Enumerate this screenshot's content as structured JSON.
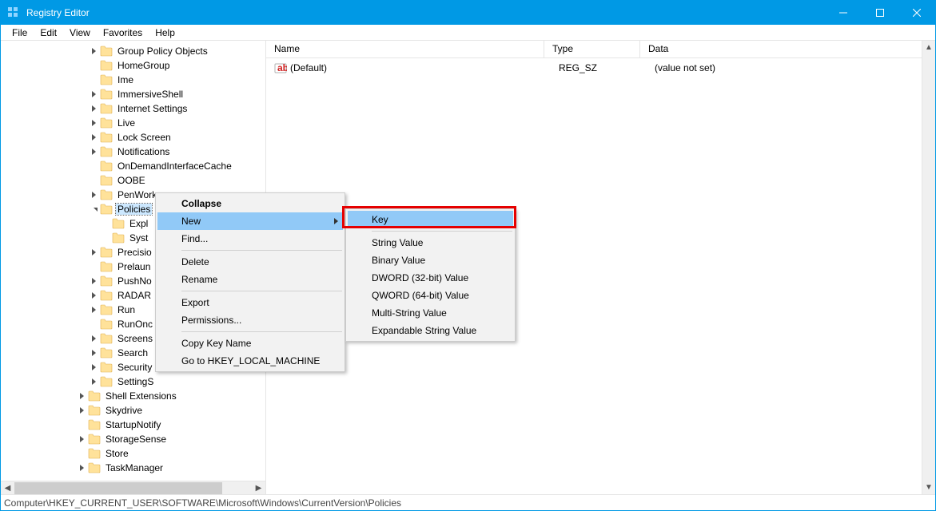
{
  "window": {
    "title": "Registry Editor",
    "minimize": "Minimize",
    "maximize": "Maximize",
    "close": "Close"
  },
  "menubar": {
    "file": "File",
    "edit": "Edit",
    "view": "View",
    "favorites": "Favorites",
    "help": "Help"
  },
  "tree": {
    "items": [
      {
        "indent": 7,
        "expander": "closed",
        "label": "Group Policy Objects"
      },
      {
        "indent": 7,
        "expander": "none",
        "label": "HomeGroup"
      },
      {
        "indent": 7,
        "expander": "none",
        "label": "Ime"
      },
      {
        "indent": 7,
        "expander": "closed",
        "label": "ImmersiveShell"
      },
      {
        "indent": 7,
        "expander": "closed",
        "label": "Internet Settings"
      },
      {
        "indent": 7,
        "expander": "closed",
        "label": "Live"
      },
      {
        "indent": 7,
        "expander": "closed",
        "label": "Lock Screen"
      },
      {
        "indent": 7,
        "expander": "closed",
        "label": "Notifications"
      },
      {
        "indent": 7,
        "expander": "none",
        "label": "OnDemandInterfaceCache"
      },
      {
        "indent": 7,
        "expander": "none",
        "label": "OOBE"
      },
      {
        "indent": 7,
        "expander": "closed",
        "label": "PenWorkspace"
      },
      {
        "indent": 7,
        "expander": "open",
        "label": "Policies",
        "selected": true
      },
      {
        "indent": 8,
        "expander": "none",
        "label": "Expl"
      },
      {
        "indent": 8,
        "expander": "none",
        "label": "Syst"
      },
      {
        "indent": 7,
        "expander": "closed",
        "label": "Precisio"
      },
      {
        "indent": 7,
        "expander": "none",
        "label": "Prelaun"
      },
      {
        "indent": 7,
        "expander": "closed",
        "label": "PushNo"
      },
      {
        "indent": 7,
        "expander": "closed",
        "label": "RADAR"
      },
      {
        "indent": 7,
        "expander": "closed",
        "label": "Run"
      },
      {
        "indent": 7,
        "expander": "none",
        "label": "RunOnc"
      },
      {
        "indent": 7,
        "expander": "closed",
        "label": "Screens"
      },
      {
        "indent": 7,
        "expander": "closed",
        "label": "Search"
      },
      {
        "indent": 7,
        "expander": "closed",
        "label": "Security"
      },
      {
        "indent": 7,
        "expander": "closed",
        "label": "SettingS"
      },
      {
        "indent": 6,
        "expander": "closed",
        "label": "Shell Extensions"
      },
      {
        "indent": 6,
        "expander": "closed",
        "label": "Skydrive"
      },
      {
        "indent": 6,
        "expander": "none",
        "label": "StartupNotify"
      },
      {
        "indent": 6,
        "expander": "closed",
        "label": "StorageSense"
      },
      {
        "indent": 6,
        "expander": "none",
        "label": "Store"
      },
      {
        "indent": 6,
        "expander": "closed",
        "label": "TaskManager"
      }
    ]
  },
  "list": {
    "headers": {
      "name": "Name",
      "type": "Type",
      "data": "Data"
    },
    "rows": [
      {
        "name": "(Default)",
        "type": "REG_SZ",
        "data": "(value not set)"
      }
    ]
  },
  "context_menu_1": {
    "collapse": "Collapse",
    "new_": "New",
    "find": "Find...",
    "delete": "Delete",
    "rename": "Rename",
    "export": "Export",
    "permissions": "Permissions...",
    "copy_key": "Copy Key Name",
    "goto_hklm": "Go to HKEY_LOCAL_MACHINE"
  },
  "context_menu_2": {
    "key": "Key",
    "string": "String Value",
    "binary": "Binary Value",
    "dword": "DWORD (32-bit) Value",
    "qword": "QWORD (64-bit) Value",
    "multi": "Multi-String Value",
    "expandable": "Expandable String Value"
  },
  "status": {
    "path": "Computer\\HKEY_CURRENT_USER\\SOFTWARE\\Microsoft\\Windows\\CurrentVersion\\Policies"
  }
}
